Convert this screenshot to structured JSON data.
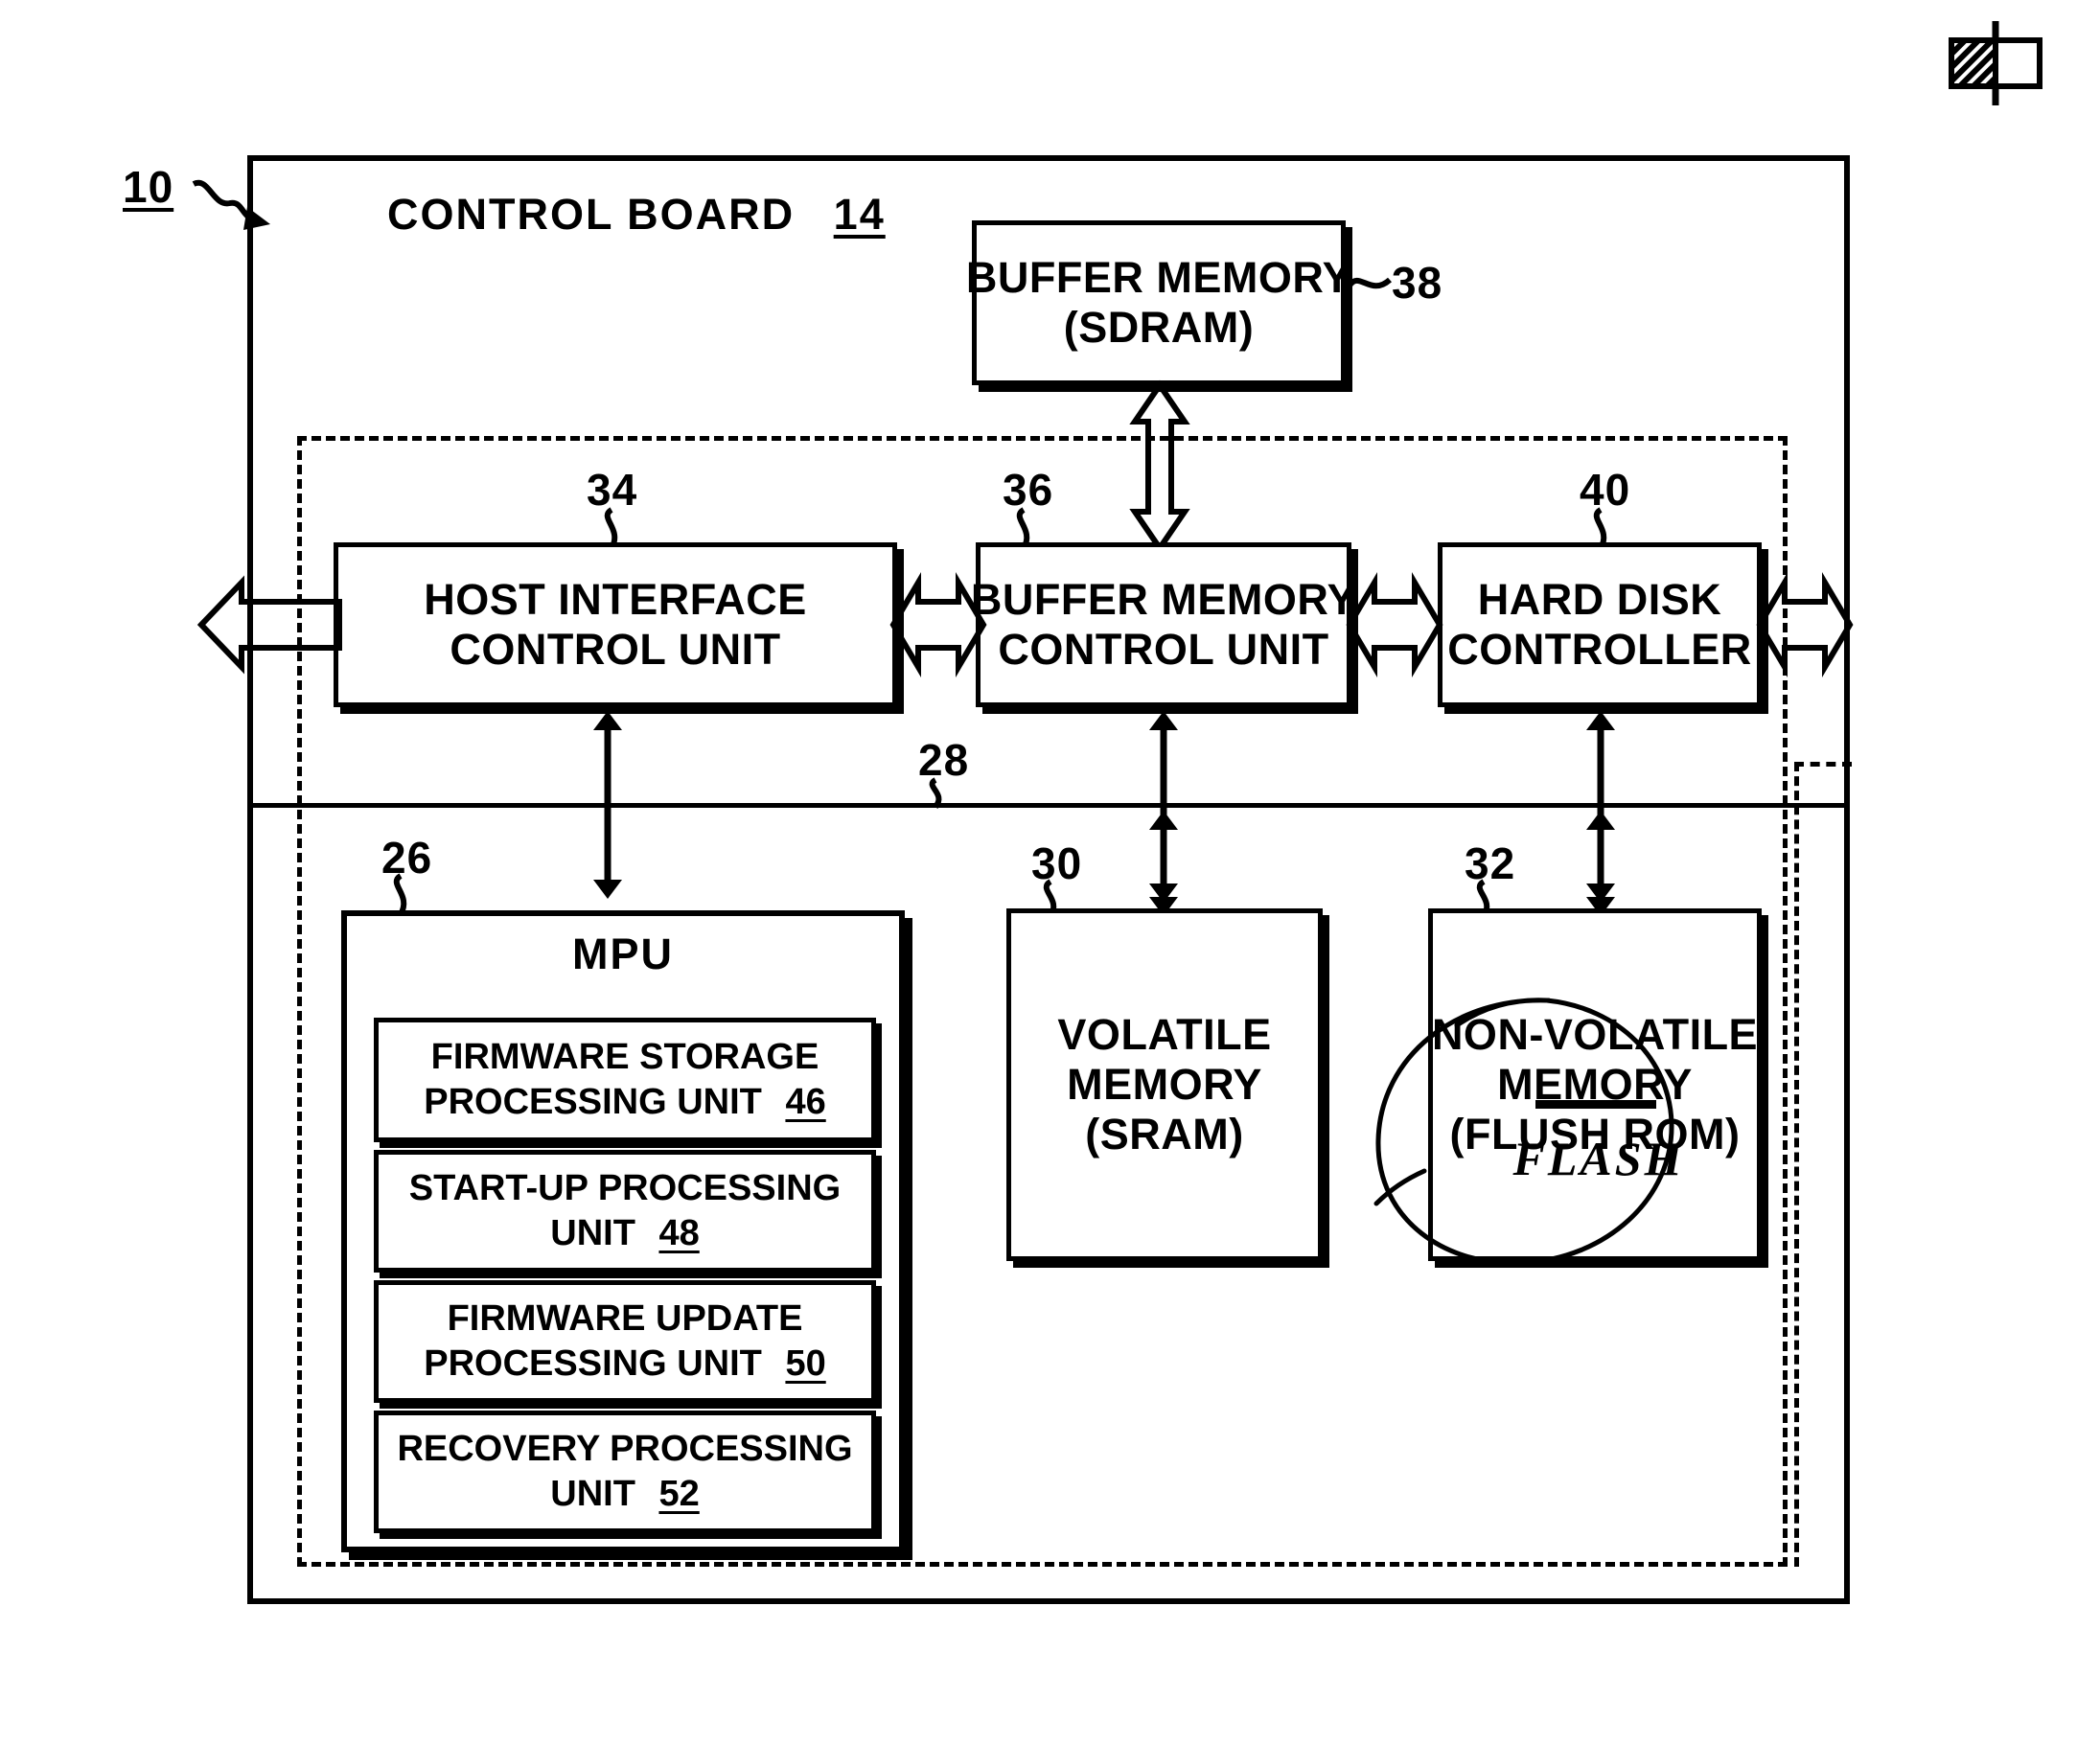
{
  "figure": {
    "title_label": "CONTROL BOARD",
    "title_ref": "14",
    "system_ref": "10",
    "bus_ref": "28",
    "corner_mark": "hatched-square-stamp"
  },
  "blocks": [
    {
      "id": "buffer-memory",
      "ref": "38",
      "ref_style": "tilde-right",
      "lines": [
        "BUFFER MEMORY",
        "(SDRAM)"
      ]
    },
    {
      "id": "host-interface-control-unit",
      "ref": "34",
      "ref_style": "squiggle-top",
      "lines": [
        "HOST INTERFACE",
        "CONTROL UNIT"
      ]
    },
    {
      "id": "buffer-memory-control-unit",
      "ref": "36",
      "ref_style": "squiggle-top",
      "lines": [
        "BUFFER MEMORY",
        "CONTROL UNIT"
      ]
    },
    {
      "id": "hard-disk-controller",
      "ref": "40",
      "ref_style": "squiggle-top",
      "lines": [
        "HARD DISK",
        "CONTROLLER"
      ]
    },
    {
      "id": "mpu",
      "ref": "26",
      "ref_style": "squiggle-top",
      "lines": [
        "MPU"
      ]
    },
    {
      "id": "volatile-memory",
      "ref": "30",
      "ref_style": "squiggle-top",
      "lines": [
        "VOLATILE",
        "MEMORY",
        "(SRAM)"
      ]
    },
    {
      "id": "non-volatile-memory",
      "ref": "32",
      "ref_style": "squiggle-top",
      "lines": [
        "NON-VOLATILE",
        "MEMORY",
        "(FLUSH ROM)"
      ]
    }
  ],
  "mpu_units": [
    {
      "id": "firmware-storage-processing-unit",
      "line1": "FIRMWARE  STORAGE",
      "line2": "PROCESSING  UNIT",
      "ref": "46"
    },
    {
      "id": "start-up-processing-unit",
      "line1": "START-UP PROCESSING",
      "line2": "UNIT",
      "ref": "48"
    },
    {
      "id": "firmware-update-processing-unit",
      "line1": "FIRMWARE UPDATE",
      "line2": "PROCESSING UNIT",
      "ref": "50"
    },
    {
      "id": "recovery-processing-unit",
      "line1": "RECOVERY PROCESSING",
      "line2": "UNIT",
      "ref": "52"
    }
  ],
  "annotation": {
    "struck_text": "FLUSH",
    "handwritten_correction": "FLASH",
    "mark": "hand-drawn-ellipse"
  },
  "colors": {
    "ink": "#000000",
    "paper": "#ffffff"
  }
}
